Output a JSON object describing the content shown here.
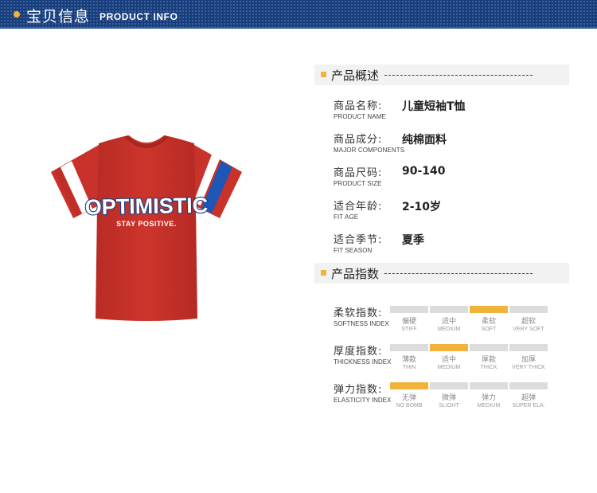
{
  "header": {
    "title_cn": "宝贝信息",
    "title_en": "PRODUCT INFO",
    "accent": "#f2b33a",
    "bar_color": "#163d7d"
  },
  "product_image": {
    "print_main": "OPTIMISTIC",
    "print_sub": "STAY POSITIVE.",
    "shirt_color": "#c8322a"
  },
  "overview": {
    "title": "产品概述",
    "rows": [
      {
        "label_cn": "商品名称:",
        "label_en": "PRODUCT NAME",
        "value": "儿童短袖T恤"
      },
      {
        "label_cn": "商品成分:",
        "label_en": "MAJOR COMPONENTS",
        "value": "纯棉面料"
      },
      {
        "label_cn": "商品尺码:",
        "label_en": "PRODUCT SIZE",
        "value": "90-140"
      },
      {
        "label_cn": "适合年龄:",
        "label_en": "FIT AGE",
        "value": "2-10岁"
      },
      {
        "label_cn": "适合季节:",
        "label_en": "FIT SEASON",
        "value": "夏季"
      }
    ]
  },
  "indices": {
    "title": "产品指数",
    "rows": [
      {
        "label_cn": "柔软指数:",
        "label_en": "SOFTNESS INDEX",
        "selected": 2,
        "options": [
          {
            "cn": "偏硬",
            "en": "STIFF"
          },
          {
            "cn": "适中",
            "en": "MEDIUM"
          },
          {
            "cn": "柔软",
            "en": "SOFT"
          },
          {
            "cn": "超软",
            "en": "VERY SOFT"
          }
        ]
      },
      {
        "label_cn": "厚度指数:",
        "label_en": "THICKNESS INDEX",
        "selected": 1,
        "options": [
          {
            "cn": "薄款",
            "en": "THIN"
          },
          {
            "cn": "适中",
            "en": "MEDIUM"
          },
          {
            "cn": "厚款",
            "en": "THICK"
          },
          {
            "cn": "加厚",
            "en": "VERY THICK"
          }
        ]
      },
      {
        "label_cn": "弹力指数:",
        "label_en": "ELASTICITY INDEX",
        "selected": 0,
        "options": [
          {
            "cn": "无弹",
            "en": "NO BOMB"
          },
          {
            "cn": "微弹",
            "en": "SLIGHT"
          },
          {
            "cn": "弹力",
            "en": "MEDIUM"
          },
          {
            "cn": "超弹",
            "en": "SUPER ELA."
          }
        ]
      }
    ]
  }
}
